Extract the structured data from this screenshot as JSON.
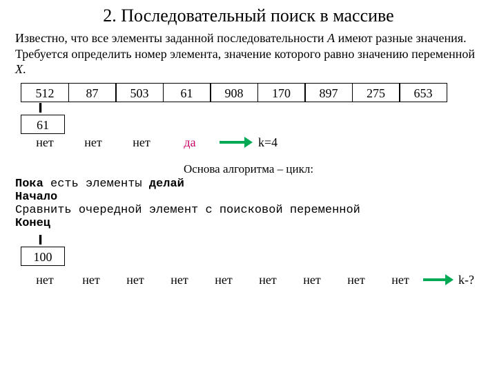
{
  "title": "2. Последовательный поиск в массиве",
  "intro_l1a": "Известно, что все элементы заданной последовательности ",
  "intro_A": "A",
  "intro_l1b": " имеют разные значения.",
  "intro_l2": "Требуется определить номер элемента, значение которого равно значению переменной ",
  "intro_X": "X",
  "intro_period": ".",
  "array": [
    "512",
    "87",
    "503",
    "61",
    "908",
    "170",
    "897",
    "275",
    "653"
  ],
  "ll_sign": "II",
  "box1": "61",
  "res1": [
    "нет",
    "нет",
    "нет",
    "да"
  ],
  "k_eq": "k=4",
  "algo_title": "Основа алгоритма – цикл:",
  "algo_l1a": "Пока",
  "algo_l1b": " есть элементы ",
  "algo_l1c": "делай",
  "algo_l2": "Начало",
  "algo_l3": "Сравнить очередной элемент с поисковой переменной",
  "algo_l4": "Конец",
  "box2": "100",
  "res2": [
    "нет",
    "нет",
    "нет",
    "нет",
    "нет",
    "нет",
    "нет",
    "нет",
    "нет"
  ],
  "k_q": "k-?",
  "colors": {
    "accent": "#00aa55",
    "da": "#cc0066"
  }
}
